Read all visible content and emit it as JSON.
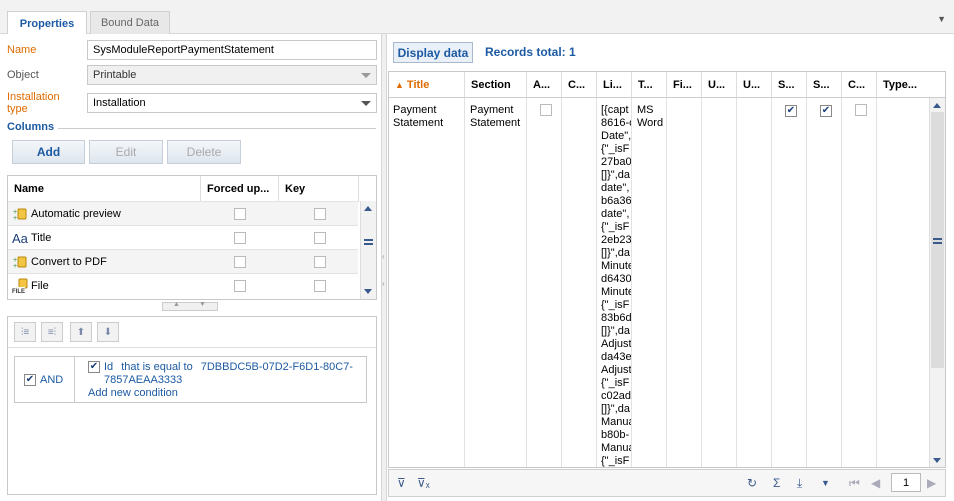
{
  "tabs": [
    {
      "label": "Properties"
    },
    {
      "label": "Bound Data"
    }
  ],
  "form": {
    "name_label": "Name",
    "name_value": "SysModuleReportPaymentStatement",
    "object_label": "Object",
    "object_value": "Printable",
    "install_label_line1": "Installation",
    "install_label_line2": "type",
    "install_value": "Installation"
  },
  "columns_section": {
    "title": "Columns",
    "add": "Add",
    "edit": "Edit",
    "delete": "Delete",
    "headers": [
      "Name",
      "Forced up...",
      "Key"
    ],
    "rows": [
      {
        "name": "Automatic preview",
        "icon": "lookup-column-icon"
      },
      {
        "name": "Title",
        "icon": "text-column-icon",
        "icon_text": "Aa"
      },
      {
        "name": "Convert to PDF",
        "icon": "lookup-column-icon"
      },
      {
        "name": "File",
        "icon": "file-column-icon"
      }
    ]
  },
  "filter": {
    "and_label": "AND",
    "condition": {
      "column": "Id",
      "operator": "that is equal to",
      "value_line1": "7DBBDC5B-07D2-F6D1-80C7-",
      "value_line2": "7857AEAA3333"
    },
    "add_condition": "Add new condition"
  },
  "data_view": {
    "display_button": "Display data",
    "records_total": "Records total: 1",
    "headers": [
      "Title",
      "Section",
      "A...",
      "C...",
      "Li...",
      "T...",
      "Fi...",
      "U...",
      "U...",
      "S...",
      "S...",
      "C...",
      "Type..."
    ],
    "row": {
      "title_line1": "Payment",
      "title_line2": "Statement",
      "section_line1": "Payment",
      "section_line2": "Statement",
      "type_line1": "MS",
      "type_line2": "Word",
      "list_lines": [
        "[{capt",
        "8616-c",
        "Date\",",
        "{\"_isF",
        "27ba0",
        "[]}\",da",
        "date\",",
        "b6a36",
        "date\",",
        "{\"_isF",
        "2eb23",
        "[]}\",da",
        "Minute",
        "d6430",
        "Minute",
        "{\"_isF",
        "83b6d",
        "[]}\",da",
        "Adjust",
        "da43e",
        "Adjust",
        "{\"_isF",
        "c02ad",
        "[]}\",da",
        "Manua",
        "b80b-",
        "Manua",
        "{\"_isF"
      ]
    },
    "page": "1"
  },
  "colors": {
    "accent": "#1c5aa3",
    "required_label": "#e06b00",
    "sort_header": "#e06b00"
  }
}
